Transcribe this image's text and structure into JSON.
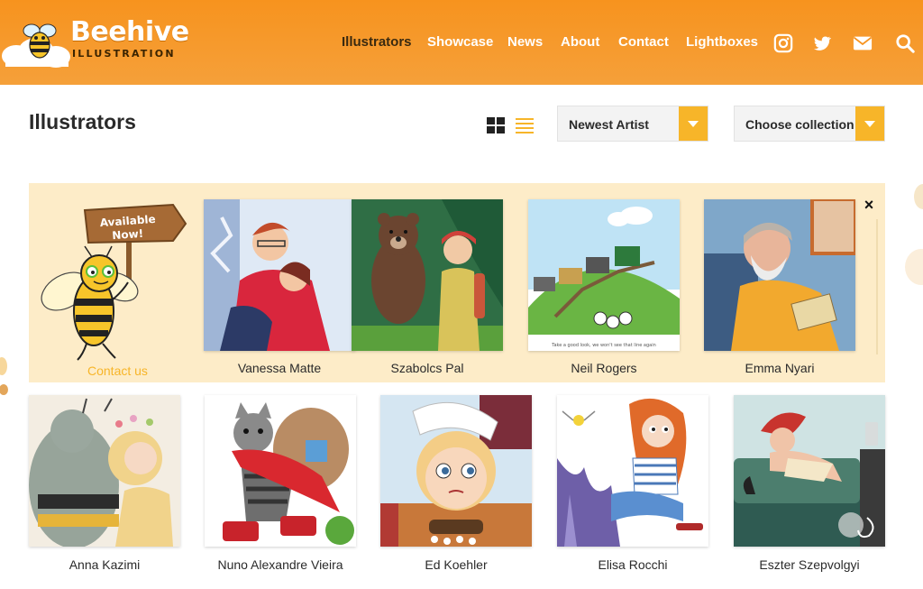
{
  "brand": {
    "title": "Beehive",
    "subtitle": "ILLUSTRATION",
    "colors": {
      "orange": "#f7931e",
      "yellow": "#f7b529",
      "cream": "#fdecc8"
    }
  },
  "nav": {
    "items": [
      {
        "label": "Illustrators",
        "active": true
      },
      {
        "label": "Showcase"
      },
      {
        "label": "News"
      },
      {
        "label": "About"
      },
      {
        "label": "Contact"
      },
      {
        "label": "Lightboxes"
      }
    ],
    "icons": [
      "instagram-icon",
      "twitter-icon",
      "mail-icon",
      "search-icon"
    ]
  },
  "page": {
    "title": "Illustrators",
    "view_modes": [
      "grid-view-icon",
      "list-view-icon"
    ],
    "sort_select": {
      "value": "Newest Artist"
    },
    "collection_select": {
      "value": "Choose collection"
    }
  },
  "featured": {
    "sign_text": "Available Now!",
    "contact_label": "Contact us",
    "close_label": "×",
    "artists": [
      {
        "name": "Vanessa Matte"
      },
      {
        "name": "Szabolcs Pal"
      },
      {
        "name": "Neil Rogers"
      },
      {
        "name": "Emma Nyari"
      }
    ]
  },
  "grid": {
    "artists": [
      {
        "name": "Anna Kazimi"
      },
      {
        "name": "Nuno Alexandre Vieira"
      },
      {
        "name": "Ed Koehler"
      },
      {
        "name": "Elisa Rocchi"
      },
      {
        "name": "Eszter Szepvolgyi"
      }
    ]
  }
}
